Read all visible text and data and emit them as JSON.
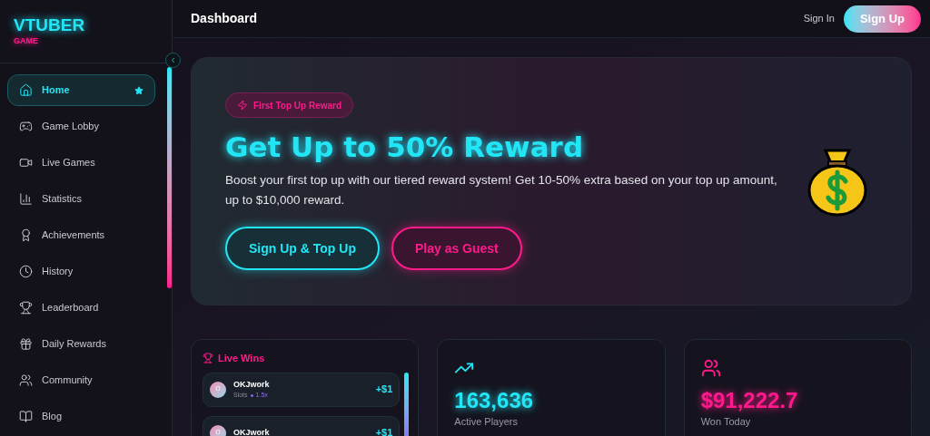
{
  "logo": {
    "title": "VTUBER",
    "subtitle": "GAME"
  },
  "sidebar": {
    "items": [
      {
        "label": "Home",
        "selected": true,
        "starred": true
      },
      {
        "label": "Game Lobby",
        "selected": false,
        "starred": false
      },
      {
        "label": "Live Games",
        "selected": false,
        "starred": false
      },
      {
        "label": "Statistics",
        "selected": false,
        "starred": false
      },
      {
        "label": "Achievements",
        "selected": false,
        "starred": false
      },
      {
        "label": "History",
        "selected": false,
        "starred": false
      },
      {
        "label": "Leaderboard",
        "selected": false,
        "starred": false
      },
      {
        "label": "Daily Rewards",
        "selected": false,
        "starred": false
      },
      {
        "label": "Community",
        "selected": false,
        "starred": false
      },
      {
        "label": "Blog",
        "selected": false,
        "starred": false
      }
    ]
  },
  "header": {
    "title": "Dashboard",
    "sign_in": "Sign In",
    "sign_up": "Sign Up"
  },
  "hero": {
    "badge": "First Top Up Reward",
    "title": "Get Up to 50% Reward",
    "text": "Boost your first top up with our tiered reward system! Get 10-50% extra based on your top up amount, up to $10,000 reward.",
    "primary_button": "Sign Up & Top Up",
    "secondary_button": "Play as Guest"
  },
  "live_wins": {
    "title": "Live Wins",
    "items": [
      {
        "avatar": "O",
        "name": "OKJwork",
        "game": "Slots",
        "multiplier": "1.5x",
        "amount": "+$1"
      },
      {
        "avatar": "O",
        "name": "OKJwork",
        "amount": "+$1"
      }
    ]
  },
  "stats": [
    {
      "value": "163,636",
      "label": "Active Players",
      "color": "#22e5f5"
    },
    {
      "value": "$91,222.7",
      "label": "Won Today",
      "color": "#ff1a8c"
    }
  ]
}
